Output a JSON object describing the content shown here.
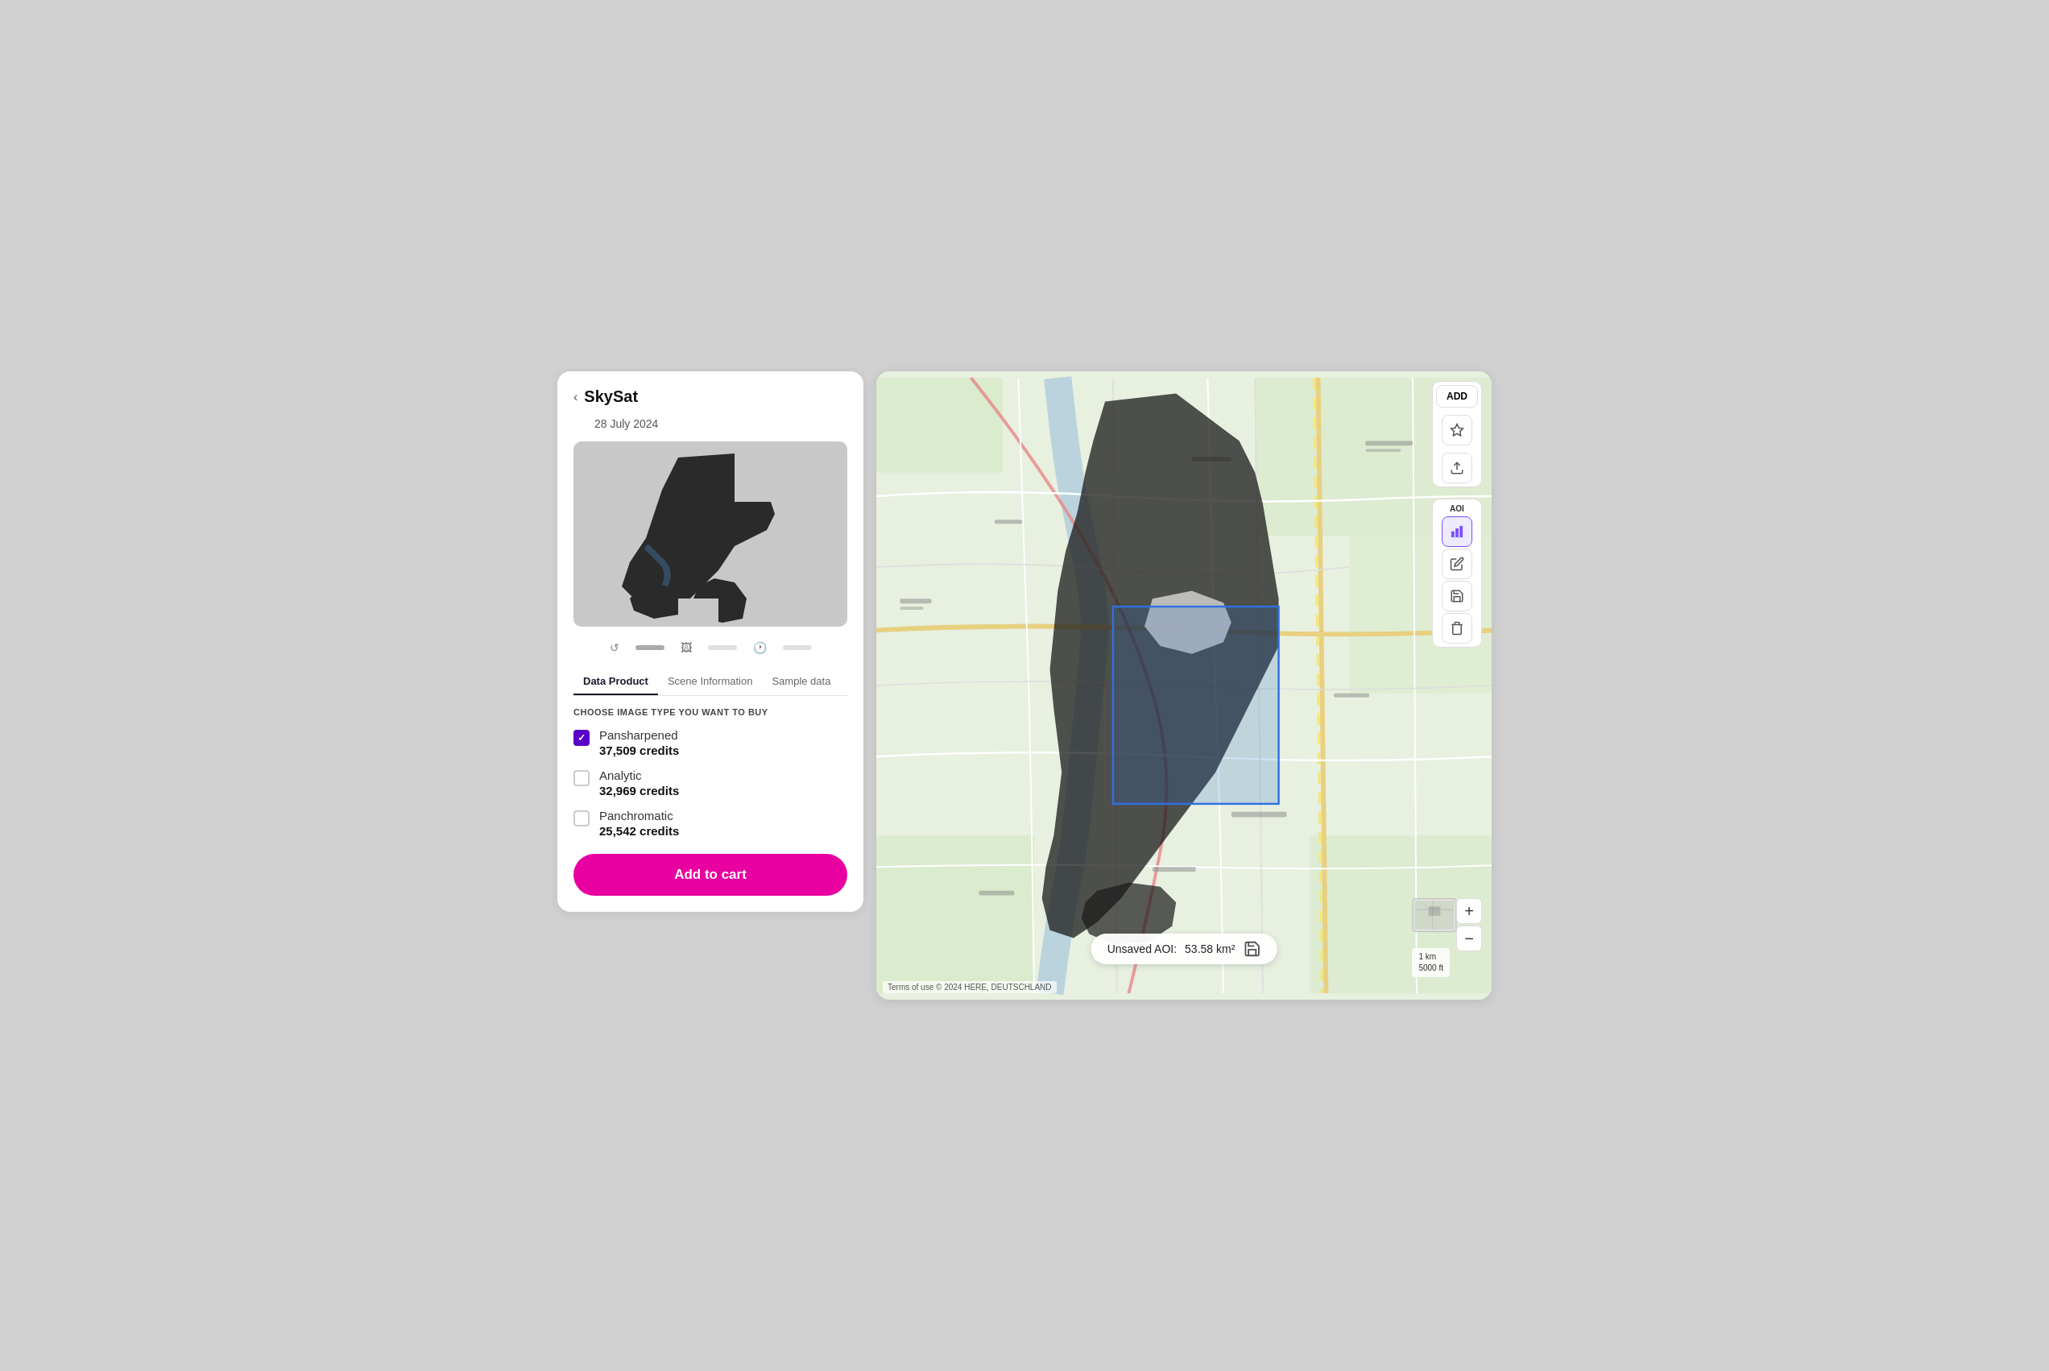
{
  "left_panel": {
    "back_label": "‹",
    "title": "SkySat",
    "date": "28 July 2024",
    "tabs": [
      {
        "label": "Data Product",
        "active": true
      },
      {
        "label": "Scene Information",
        "active": false
      },
      {
        "label": "Sample data",
        "active": false
      }
    ],
    "section_label": "CHOOSE IMAGE TYPE YOU WANT TO BUY",
    "products": [
      {
        "name": "Pansharpened",
        "credits": "37,509 credits",
        "checked": true
      },
      {
        "name": "Analytic",
        "credits": "32,969 credits",
        "checked": false
      },
      {
        "name": "Panchromatic",
        "credits": "25,542 credits",
        "checked": false
      }
    ],
    "add_to_cart": "Add to cart"
  },
  "map": {
    "toolbar": {
      "add_label": "ADD",
      "aoi_label": "AOI"
    },
    "aoi_info": {
      "label": "Unsaved AOI:",
      "area": "53.58 km²"
    },
    "attribution": "Terms of use © 2024 HERE, DEUTSCHLAND",
    "scale": {
      "km": "1 km",
      "ft": "5000 ft"
    }
  }
}
